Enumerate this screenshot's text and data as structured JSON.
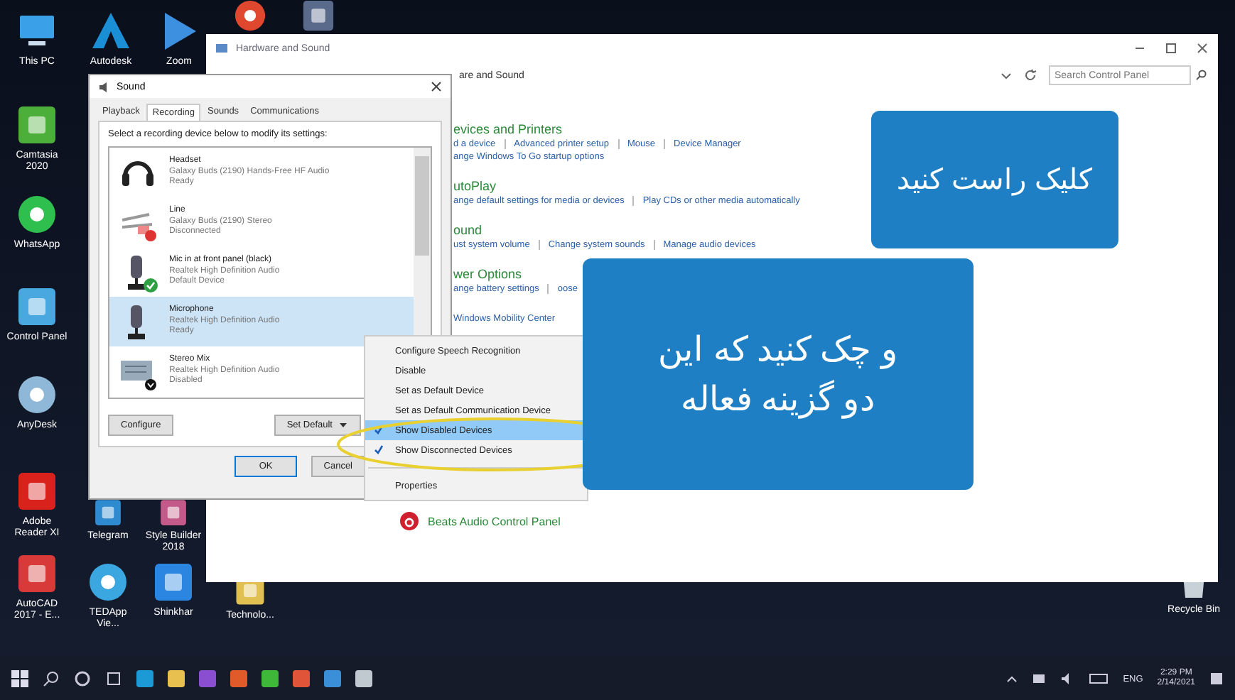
{
  "desktop_icons": [
    {
      "label": "This PC",
      "kind": "pc",
      "color": "#3aa0e8"
    },
    {
      "label": "Autodesk",
      "kind": "logo",
      "color": "#1b8fd6"
    },
    {
      "label": "Zoom",
      "kind": "play",
      "color": "#3d8fe0"
    },
    {
      "kind": "round",
      "color": "#e0472f"
    },
    {
      "kind": "tile",
      "color": "#5a6a8a"
    },
    {
      "label": "Camtasia 2020",
      "kind": "tile",
      "color": "#4caf3a"
    },
    {
      "label": "WhatsApp",
      "kind": "round",
      "color": "#2fbf4f"
    },
    {
      "label": "Control Panel",
      "kind": "tile",
      "color": "#4aa8e0"
    },
    {
      "label": "AnyDesk",
      "kind": "round",
      "color": "#8fb8d8"
    },
    {
      "label": "Adobe Reader XI",
      "kind": "tile",
      "color": "#d9221c"
    },
    {
      "label": "AutoCAD 2017 - E...",
      "kind": "tile",
      "color": "#d83a3a"
    },
    {
      "label": "Telegram",
      "kind": "tile",
      "color": "#2f8bd0"
    },
    {
      "label": "Style Builder 2018",
      "kind": "tile",
      "color": "#c45a8a"
    },
    {
      "label": "TEDApp Vie...",
      "kind": "round",
      "color": "#3aa7e0"
    },
    {
      "label": "Shinkhar",
      "kind": "tile",
      "color": "#2a86e0"
    },
    {
      "label": "Technolo...",
      "kind": "tile",
      "color": "#e0c050"
    },
    {
      "label": "Recycle Bin",
      "kind": "bin",
      "color": "#c8d0d8"
    }
  ],
  "control_panel": {
    "title": "Hardware and Sound",
    "path": "are and Sound",
    "search": {
      "placeholder": "Search Control Panel"
    },
    "sections": [
      {
        "heading": "evices and Printers",
        "links": [
          "d a device",
          "Advanced printer setup",
          "Mouse",
          "Device Manager"
        ],
        "links2": [
          "ange Windows To Go startup options"
        ]
      },
      {
        "heading": "utoPlay",
        "links": [
          "ange default settings for media or devices",
          "Play CDs or other media automatically"
        ]
      },
      {
        "heading": "ound",
        "links": [
          "ust system volume",
          "Change system sounds",
          "Manage audio devices"
        ]
      },
      {
        "heading": "wer Options",
        "links": [
          "ange battery settings",
          "oose"
        ]
      },
      {
        "links": [
          "Windows Mobility Center"
        ]
      }
    ],
    "beats": "Beats Audio Control Panel"
  },
  "sound_dialog": {
    "title": "Sound",
    "tabs": [
      {
        "label": "Playback",
        "selected": false
      },
      {
        "label": "Recording",
        "selected": true
      },
      {
        "label": "Sounds",
        "selected": false
      },
      {
        "label": "Communications",
        "selected": false
      }
    ],
    "instruction": "Select a recording device below to modify its settings:",
    "devices": [
      {
        "name": "Headset",
        "description": "Galaxy Buds (2190) Hands-Free HF Audio",
        "status": "Ready",
        "kind": "headset",
        "default_device": false,
        "disconnected": false,
        "disabled": false,
        "selected": false
      },
      {
        "name": "Line",
        "description": "Galaxy Buds (2190) Stereo",
        "status": "Disconnected",
        "kind": "line",
        "default_device": false,
        "disconnected": true,
        "disabled": false,
        "selected": false
      },
      {
        "name": "Mic in at front panel (black)",
        "description": "Realtek High Definition Audio",
        "status": "Default Device",
        "kind": "mic",
        "default_device": true,
        "disconnected": false,
        "disabled": false,
        "selected": false
      },
      {
        "name": "Microphone",
        "description": "Realtek High Definition Audio",
        "status": "Ready",
        "kind": "mic",
        "default_device": false,
        "disconnected": false,
        "disabled": false,
        "selected": true
      },
      {
        "name": "Stereo Mix",
        "description": "Realtek High Definition Audio",
        "status": "Disabled",
        "kind": "board",
        "default_device": false,
        "disconnected": false,
        "disabled": true,
        "selected": false
      }
    ],
    "configure": "Configure",
    "set_default": "Set Default",
    "ok": "OK",
    "cancel": "Cancel"
  },
  "context_menu": [
    {
      "label": "Configure Speech Recognition",
      "checked": false,
      "selected": false
    },
    {
      "label": "Disable",
      "checked": false,
      "selected": false
    },
    {
      "label": "Set as Default Device",
      "checked": false,
      "selected": false
    },
    {
      "label": "Set as Default Communication Device",
      "checked": false,
      "selected": false
    },
    {
      "label": "Show Disabled Devices",
      "checked": true,
      "selected": true
    },
    {
      "label": "Show Disconnected Devices",
      "checked": true,
      "selected": false
    },
    {
      "label": "Properties",
      "checked": false,
      "selected": false
    }
  ],
  "callouts": [
    {
      "lines": [
        "کلیک راست کنید"
      ]
    },
    {
      "lines": [
        "و چک کنید که این",
        "دو گزینه فعاله"
      ]
    }
  ],
  "taskbar": {
    "apps": [
      {
        "color": "#1c9ad6"
      },
      {
        "color": "#e8c050"
      },
      {
        "color": "#8a4fd0"
      },
      {
        "color": "#e05a2a"
      },
      {
        "color": "#3fb83a"
      },
      {
        "color": "#e0553a"
      },
      {
        "color": "#3a8fd8"
      },
      {
        "color": "#c0c8d0"
      }
    ],
    "language": "ENG",
    "time": "2:29 PM",
    "date": "2/14/2021"
  }
}
